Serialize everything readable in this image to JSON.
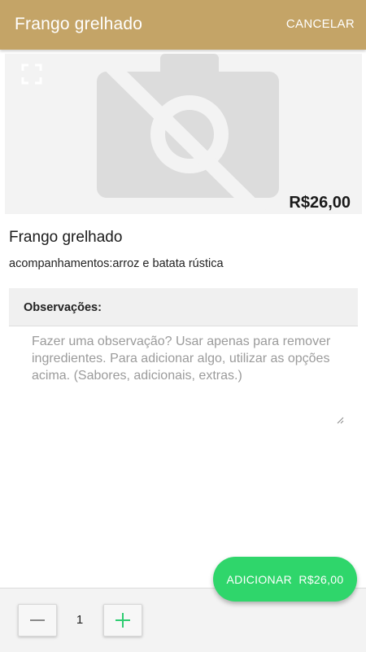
{
  "appbar": {
    "title": "Frango grelhado",
    "cancel_label": "CANCELAR"
  },
  "product": {
    "price_overlay": "R$26,00",
    "name": "Frango grelhado",
    "description": "acompanhamentos:arroz e batata rústica",
    "image_icons": [
      "expand-icon",
      "no-photo-icon"
    ]
  },
  "observations": {
    "label": "Observações:",
    "value": "",
    "placeholder": "Fazer uma observação? Usar apenas para remover ingredientes. Para adicionar algo, utilizar as opções acima. (Sabores, adicionais, extras.)"
  },
  "quantity": {
    "value": "1",
    "minus_icon": "minus-icon",
    "plus_icon": "plus-icon"
  },
  "add_button": {
    "label": "ADICIONAR",
    "price": "R$26,00"
  },
  "colors": {
    "appbar": "#c4a467",
    "add_button": "#2fd66b",
    "plus_icon": "#2ecc71"
  }
}
